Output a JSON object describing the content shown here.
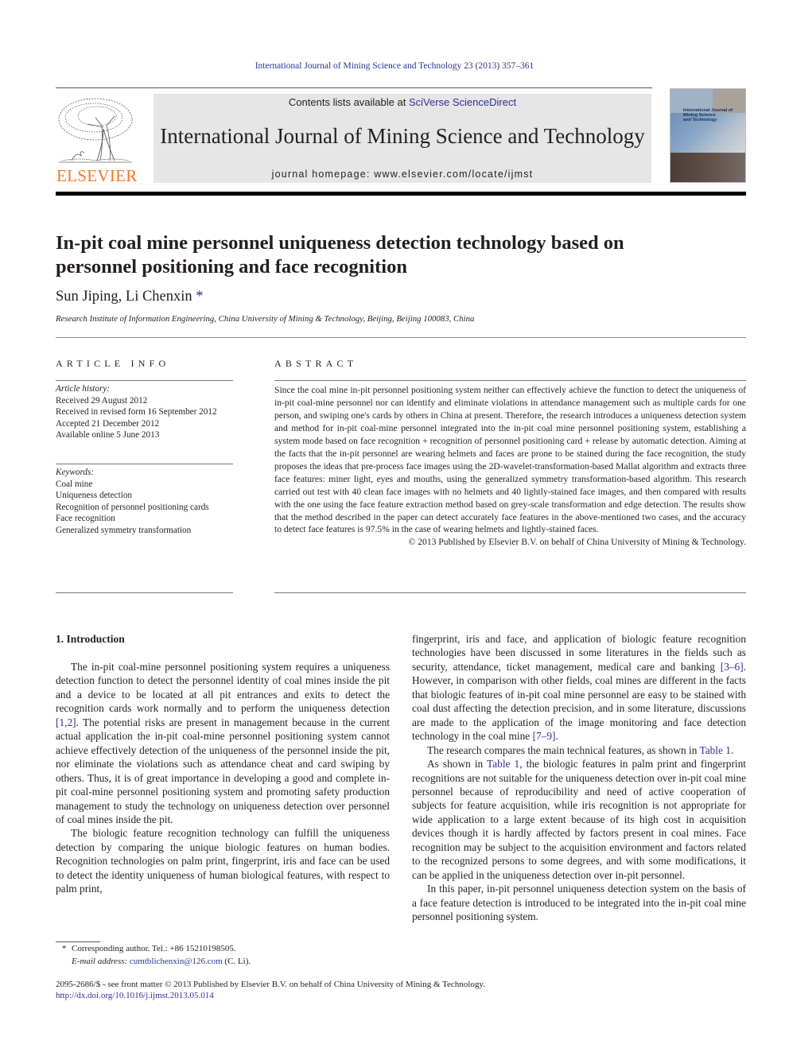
{
  "header": {
    "citation": "International Journal of Mining Science and Technology 23 (2013) 357–361",
    "contents_prefix": "Contents lists available at ",
    "contents_link": "SciVerse ScienceDirect",
    "journal_name": "International Journal of Mining Science and Technology",
    "homepage_prefix": "journal homepage: ",
    "homepage_url": "www.elsevier.com/locate/ijmst",
    "publisher_logo_text": "ELSEVIER",
    "cover_title_lines": [
      "International Journal of",
      "Mining Science",
      "and Technology"
    ]
  },
  "article": {
    "title": "In-pit coal mine personnel uniqueness detection technology based on personnel positioning and face recognition",
    "authors": "Sun Jiping, Li Chenxin",
    "author_marker": "*",
    "affiliation": "Research Institute of Information Engineering, China University of Mining & Technology, Beijing, Beijing 100083, China"
  },
  "article_info": {
    "label": "ARTICLE INFO",
    "history_heading": "Article history:",
    "history": [
      "Received 29 August 2012",
      "Received in revised form 16 September 2012",
      "Accepted 21 December 2012",
      "Available online 5 June 2013"
    ],
    "keywords_heading": "Keywords:",
    "keywords": [
      "Coal mine",
      "Uniqueness detection",
      "Recognition of personnel positioning cards",
      "Face recognition",
      "Generalized symmetry transformation"
    ]
  },
  "abstract": {
    "label": "ABSTRACT",
    "text": "Since the coal mine in-pit personnel positioning system neither can effectively achieve the function to detect the uniqueness of in-pit coal-mine personnel nor can identify and eliminate violations in attendance management such as multiple cards for one person, and swiping one's cards by others in China at present. Therefore, the research introduces a uniqueness detection system and method for in-pit coal-mine personnel integrated into the in-pit coal mine personnel positioning system, establishing a system mode based on face recognition + recognition of personnel positioning card + release by automatic detection. Aiming at the facts that the in-pit personnel are wearing helmets and faces are prone to be stained during the face recognition, the study proposes the ideas that pre-process face images using the 2D-wavelet-transformation-based Mallat algorithm and extracts three face features: miner light, eyes and mouths, using the generalized symmetry transformation-based algorithm. This research carried out test with 40 clean face images with no helmets and 40 lightly-stained face images, and then compared with results with the one using the face feature extraction method based on grey-scale transformation and edge detection. The results show that the method described in the paper can detect accurately face features in the above-mentioned two cases, and the accuracy to detect face features is 97.5% in the case of wearing helmets and lightly-stained faces.",
    "copyright": "© 2013 Published by Elsevier B.V. on behalf of China University of Mining & Technology."
  },
  "body": {
    "section_heading": "1. Introduction",
    "left": {
      "p1_a": "The in-pit coal-mine personnel positioning system requires a uniqueness detection function to detect the personnel identity of coal mines inside the pit and a device to be located at all pit en­trances and exits to detect the recognition cards work normally and to perform the uniqueness detection ",
      "p1_ref": "[1,2]",
      "p1_b": ". The potential risks are present in management because in the current actual applica­tion the in-pit coal-mine personnel positioning system cannot achieve effectively detection of the uniqueness of the personnel in­side the pit, nor eliminate the violations such as attendance cheat and card swiping by others. Thus, it is of great importance in devel­oping a good and complete in-pit coal-mine personnel positioning system and promoting safety production management to study the technology on uniqueness detection over personnel of coal mines inside the pit.",
      "p2": "The biologic feature recognition technology can fulfill the uniqueness detection by comparing the unique biologic features on human bodies. Recognition technologies on palm print, finger­print, iris and face can be used to detect the identity uniqueness of human biological features, with respect to palm print,"
    },
    "right": {
      "p1_a": "fingerprint, iris and face, and application of biologic feature recognition technologies have been discussed in some literatures in the fields such as security, attendance, ticket management, medical care and banking ",
      "p1_ref1": "[3–6]",
      "p1_b": ". However, in comparison with other fields, coal mines are different in the facts that biologic features of in-pit coal mine personnel are easy to be stained with coal dust affecting the detection precision, and in some literature, discussions are made to the application of the image monitoring and face detection technology in the coal mine ",
      "p1_ref2": "[7–9]",
      "p1_c": ".",
      "p2_a": "The research compares the main technical features, as shown in ",
      "p2_ref": "Table 1",
      "p2_b": ".",
      "p3_a": "As shown in ",
      "p3_ref": "Table 1",
      "p3_b": ", the biologic features in palm print and finger­print recognitions are not suitable for the uniqueness detection over in-pit coal mine personnel because of reproducibility and need of ac­tive cooperation of subjects for feature acquisition, while iris recog­nition is not appropriate for wide application to a large extent because of its high cost in acquisition devices though it is hardly af­fected by factors present in coal mines. Face recognition may be sub­ject to the acquisition environment and factors related to the recognized persons to some degrees, and with some modifications, it can be applied in the uniqueness detection over in-pit personnel.",
      "p4": "In this paper, in-pit personnel uniqueness detection system on the basis of a face feature detection is introduced to be integrated into the in-pit coal mine personnel positioning system."
    }
  },
  "footnote": {
    "marker": "*",
    "corresponding": "Corresponding author. Tel.: +86 15210198505.",
    "email_label": "E-mail address:",
    "email": "cumtblichenxin@126.com",
    "email_suffix": " (C. Li)."
  },
  "front_matter": {
    "issn_line": "2095-2686/$ - see front matter © 2013 Published by Elsevier B.V. on behalf of China University of Mining & Technology.",
    "doi": "http://dx.doi.org/10.1016/j.ijmst.2013.05.014"
  },
  "colors": {
    "link": "#2e3192",
    "elsevier_orange": "#f47920",
    "banner_bg": "#e6e6e6"
  }
}
